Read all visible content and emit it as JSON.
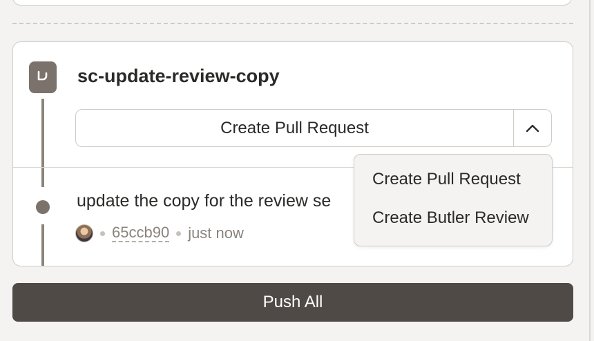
{
  "branch": {
    "name": "sc-update-review-copy",
    "icon": "branch-icon"
  },
  "pr_button": {
    "label": "Create Pull Request",
    "toggle_icon": "chevron-up-icon"
  },
  "dropdown": {
    "items": [
      {
        "label": "Create Pull Request"
      },
      {
        "label": "Create Butler Review"
      }
    ]
  },
  "commit": {
    "message": "update the copy for the review se",
    "sha": "65ccb90",
    "time": "just now",
    "avatar": "avatar"
  },
  "push_button": {
    "label": "Push All"
  },
  "colors": {
    "background": "#f4f3f1",
    "card": "#ffffff",
    "border": "#cfcbc6",
    "icon_bg": "#7b726b",
    "primary_button": "#4f4a46",
    "muted_text": "#8a847e"
  }
}
